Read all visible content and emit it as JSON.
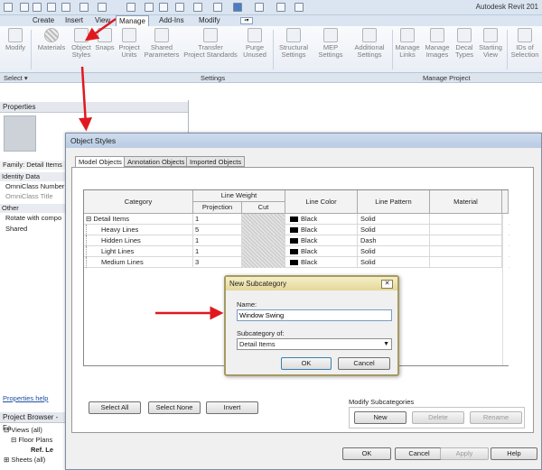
{
  "app_title": "Autodesk Revit 201",
  "ribbon_tabs": [
    "Create",
    "Insert",
    "View",
    "Manage",
    "Add-Ins",
    "Modify"
  ],
  "ribbon_buttons": [
    {
      "label": "Modify",
      "icon": "cursor-icon"
    },
    {
      "label": "Materials",
      "icon": "materials-icon"
    },
    {
      "label": "Object\nStyles",
      "icon": "object-styles-icon"
    },
    {
      "label": "Snaps",
      "icon": "snaps-icon"
    },
    {
      "label": "Project\nUnits",
      "icon": "units-icon"
    },
    {
      "label": "Shared\nParameters",
      "icon": "shared-params-icon"
    },
    {
      "label": "Transfer\nProject Standards",
      "icon": "transfer-icon"
    },
    {
      "label": "Purge\nUnused",
      "icon": "purge-icon"
    },
    {
      "label": "Structural\nSettings",
      "icon": "structural-icon"
    },
    {
      "label": "MEP\nSettings",
      "icon": "mep-icon"
    },
    {
      "label": "Additional\nSettings",
      "icon": "wrench-icon"
    },
    {
      "label": "Manage\nLinks",
      "icon": "links-icon"
    },
    {
      "label": "Manage\nImages",
      "icon": "images-icon"
    },
    {
      "label": "Decal\nTypes",
      "icon": "decal-icon"
    },
    {
      "label": "Starting\nView",
      "icon": "starting-view-icon"
    },
    {
      "label": "IDs of\nSelection",
      "icon": "ids-icon"
    }
  ],
  "panel_labels": {
    "select": "Select ▾",
    "settings": "Settings",
    "manage_project": "Manage Project"
  },
  "properties": {
    "title": "Properties",
    "family": "Family: Detail Items",
    "groups": [
      {
        "header": "Identity Data",
        "rows": [
          "OmniClass Number",
          "OmniClass Title"
        ]
      },
      {
        "header": "Other",
        "rows": [
          "Rotate with compo",
          "Shared"
        ]
      }
    ],
    "help_link": "Properties help"
  },
  "project_browser": {
    "title": "Project Browser - Fa",
    "items": [
      "Views (all)",
      "Floor Plans",
      "Ref. Le",
      "Sheets (all)"
    ]
  },
  "object_styles": {
    "title": "Object Styles",
    "tabs": [
      "Model Objects",
      "Annotation Objects",
      "Imported Objects"
    ],
    "headers": {
      "category": "Category",
      "line_weight": "Line Weight",
      "projection": "Projection",
      "cut": "Cut",
      "line_color": "Line Color",
      "line_pattern": "Line Pattern",
      "material": "Material"
    },
    "rows": [
      {
        "category": "Detail Items",
        "projection": "1",
        "color": "Black",
        "pattern": "Solid",
        "expander": "⊟"
      },
      {
        "category": "Heavy Lines",
        "projection": "5",
        "color": "Black",
        "pattern": "Solid",
        "expander": ""
      },
      {
        "category": "Hidden Lines",
        "projection": "1",
        "color": "Black",
        "pattern": "Dash",
        "expander": ""
      },
      {
        "category": "Light Lines",
        "projection": "1",
        "color": "Black",
        "pattern": "Solid",
        "expander": ""
      },
      {
        "category": "Medium Lines",
        "projection": "3",
        "color": "Black",
        "pattern": "Solid",
        "expander": ""
      }
    ],
    "buttons": {
      "select_all": "Select All",
      "select_none": "Select None",
      "invert": "Invert"
    },
    "modify_subcategories": {
      "title": "Modify Subcategories",
      "new": "New",
      "delete": "Delete",
      "rename": "Rename"
    },
    "footer": {
      "ok": "OK",
      "cancel": "Cancel",
      "apply": "Apply",
      "help": "Help"
    }
  },
  "new_subcategory": {
    "title": "New Subcategory",
    "name_label": "Name:",
    "name_value": "Window Swing",
    "subcategory_label": "Subcategory of:",
    "subcategory_value": "Detail Items",
    "ok": "OK",
    "cancel": "Cancel"
  },
  "annotation_color": "#e0191f"
}
